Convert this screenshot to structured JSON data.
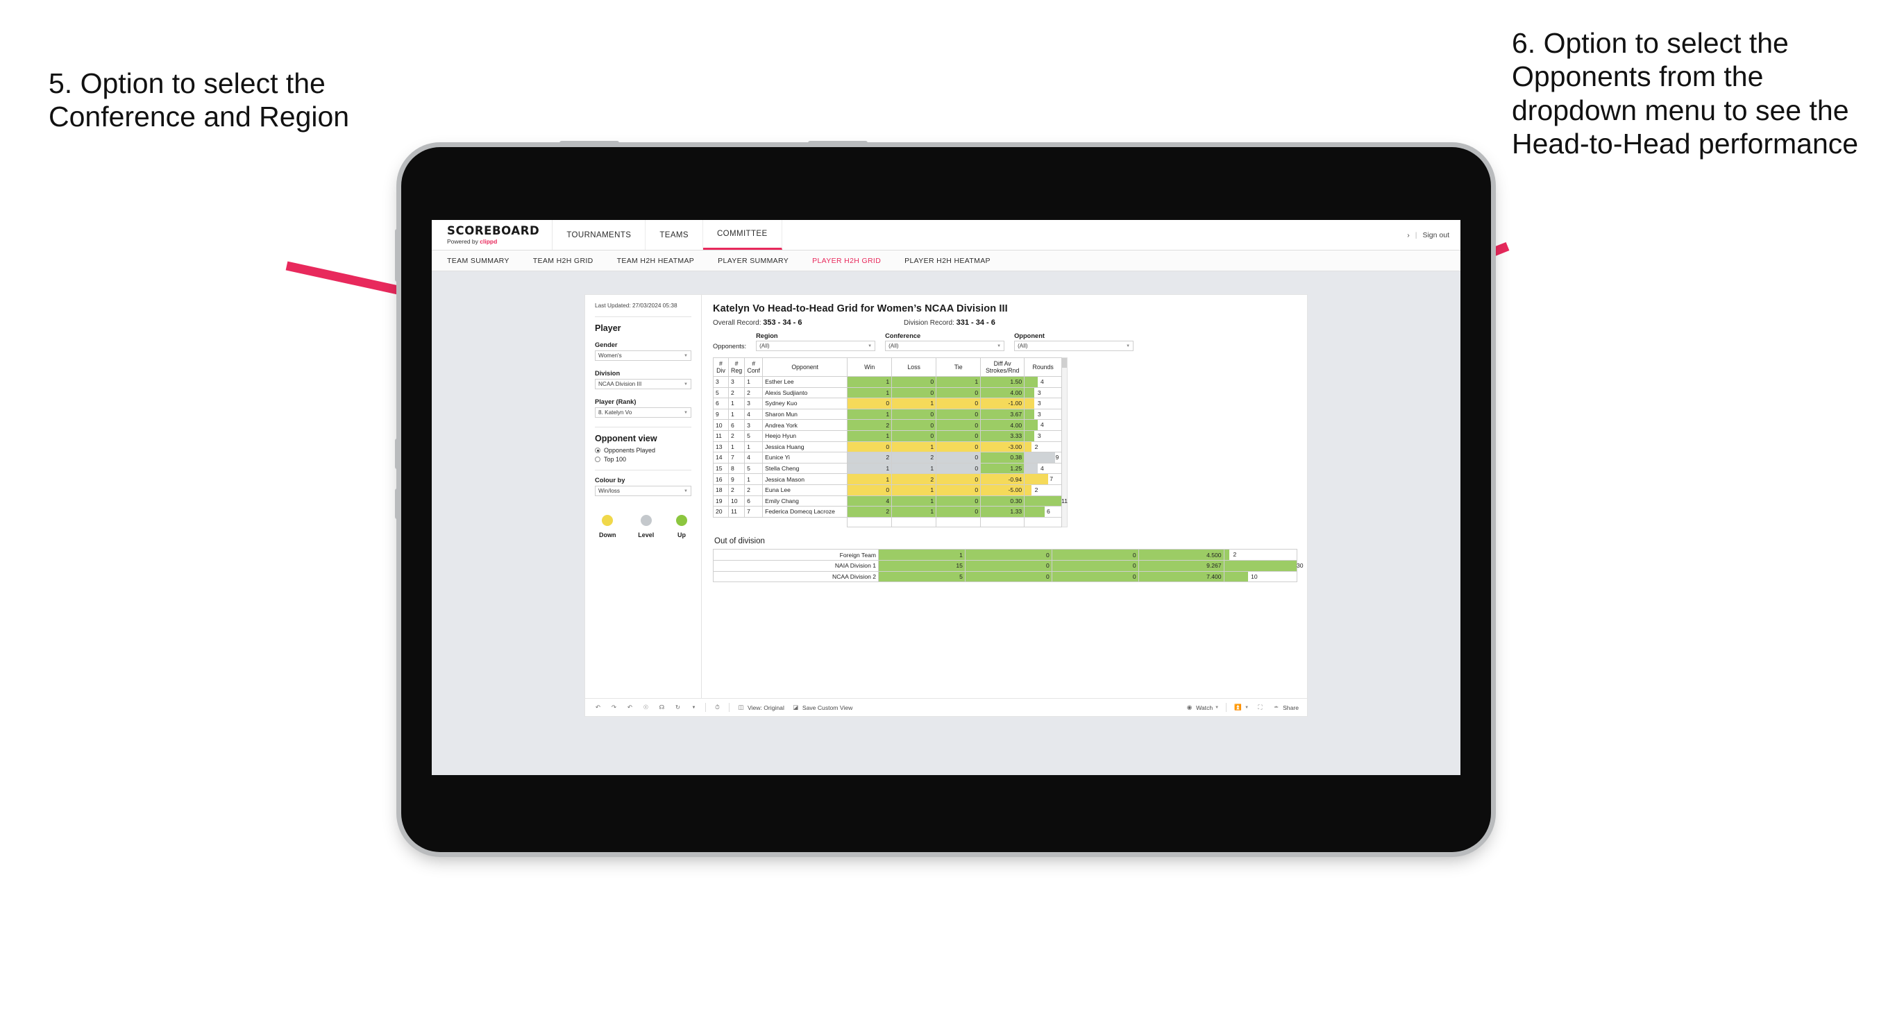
{
  "annotations": {
    "left": "5. Option to select the Conference and Region",
    "right": "6. Option to select the Opponents from the dropdown menu to see the Head-to-Head performance",
    "arrow_color": "#E8295C"
  },
  "app": {
    "brand": {
      "name": "SCOREBOARD",
      "powered_prefix": "Powered by ",
      "powered_brand": "clippd"
    },
    "topnav": [
      {
        "label": "TOURNAMENTS",
        "active": false
      },
      {
        "label": "TEAMS",
        "active": false
      },
      {
        "label": "COMMITTEE",
        "active": true
      }
    ],
    "topbar_right": {
      "chevron": "›",
      "separator": "|",
      "sign_out": "Sign out"
    },
    "subnav": [
      {
        "label": "TEAM SUMMARY",
        "active": false
      },
      {
        "label": "TEAM H2H GRID",
        "active": false
      },
      {
        "label": "TEAM H2H HEATMAP",
        "active": false
      },
      {
        "label": "PLAYER SUMMARY",
        "active": false
      },
      {
        "label": "PLAYER H2H GRID",
        "active": true
      },
      {
        "label": "PLAYER H2H HEATMAP",
        "active": false
      }
    ]
  },
  "sidebar": {
    "last_updated": "Last Updated: 27/03/2024 05:38",
    "player_heading": "Player",
    "fields": [
      {
        "label": "Gender",
        "value": "Women's"
      },
      {
        "label": "Division",
        "value": "NCAA Division III"
      },
      {
        "label": "Player (Rank)",
        "value": "8. Katelyn Vo"
      }
    ],
    "opponent_view": {
      "heading": "Opponent view",
      "options": [
        {
          "label": "Opponents Played",
          "selected": true
        },
        {
          "label": "Top 100",
          "selected": false
        }
      ]
    },
    "colour_by": {
      "label": "Colour by",
      "value": "Win/loss"
    },
    "legend": [
      {
        "label": "Down",
        "color": "#F0D84A"
      },
      {
        "label": "Level",
        "color": "#C4C8CC"
      },
      {
        "label": "Up",
        "color": "#8CC63F"
      }
    ]
  },
  "viz": {
    "title": "Katelyn Vo Head-to-Head Grid for Women’s NCAA Division III",
    "overall_record_label": "Overall Record:",
    "overall_record_value": "353 - 34 - 6",
    "division_record_label": "Division Record:",
    "division_record_value": "331 - 34 - 6",
    "opponents_label": "Opponents:",
    "filters": [
      {
        "label": "Region",
        "value": "(All)"
      },
      {
        "label": "Conference",
        "value": "(All)"
      },
      {
        "label": "Opponent",
        "value": "(All)"
      }
    ]
  },
  "chart_data": {
    "type": "table",
    "title": "Katelyn Vo Head-to-Head Grid for Women’s NCAA Division III",
    "columns": [
      "# Div",
      "# Reg",
      "# Conf",
      "Opponent",
      "Win",
      "Loss",
      "Tie",
      "Diff Av Strokes/Rnd",
      "Rounds"
    ],
    "headers_two_line": [
      {
        "top": "#",
        "bottom": "Div"
      },
      {
        "top": "#",
        "bottom": "Reg"
      },
      {
        "top": "#",
        "bottom": "Conf"
      },
      {
        "top": "Opponent",
        "bottom": ""
      },
      {
        "top": "Win",
        "bottom": ""
      },
      {
        "top": "Loss",
        "bottom": ""
      },
      {
        "top": "Tie",
        "bottom": ""
      },
      {
        "top": "Diff Av",
        "bottom": "Strokes/Rnd"
      },
      {
        "top": "Rounds",
        "bottom": ""
      }
    ],
    "rounds_max": 11,
    "rows": [
      {
        "div": "3",
        "reg": "3",
        "conf": "1",
        "opponent": "Esther Lee",
        "win": "1",
        "loss": "0",
        "tie": "1",
        "diff": "1.50",
        "rounds": 4,
        "state": "up"
      },
      {
        "div": "5",
        "reg": "2",
        "conf": "2",
        "opponent": "Alexis Sudjianto",
        "win": "1",
        "loss": "0",
        "tie": "0",
        "diff": "4.00",
        "rounds": 3,
        "state": "up"
      },
      {
        "div": "6",
        "reg": "1",
        "conf": "3",
        "opponent": "Sydney Kuo",
        "win": "0",
        "loss": "1",
        "tie": "0",
        "diff": "-1.00",
        "rounds": 3,
        "state": "down"
      },
      {
        "div": "9",
        "reg": "1",
        "conf": "4",
        "opponent": "Sharon Mun",
        "win": "1",
        "loss": "0",
        "tie": "0",
        "diff": "3.67",
        "rounds": 3,
        "state": "up"
      },
      {
        "div": "10",
        "reg": "6",
        "conf": "3",
        "opponent": "Andrea York",
        "win": "2",
        "loss": "0",
        "tie": "0",
        "diff": "4.00",
        "rounds": 4,
        "state": "up"
      },
      {
        "div": "11",
        "reg": "2",
        "conf": "5",
        "opponent": "Heejo Hyun",
        "win": "1",
        "loss": "0",
        "tie": "0",
        "diff": "3.33",
        "rounds": 3,
        "state": "up"
      },
      {
        "div": "13",
        "reg": "1",
        "conf": "1",
        "opponent": "Jessica Huang",
        "win": "0",
        "loss": "1",
        "tie": "0",
        "diff": "-3.00",
        "rounds": 2,
        "state": "down"
      },
      {
        "div": "14",
        "reg": "7",
        "conf": "4",
        "opponent": "Eunice Yi",
        "win": "2",
        "loss": "2",
        "tie": "0",
        "diff": "0.38",
        "rounds": 9,
        "state": "level",
        "diff_state": "up"
      },
      {
        "div": "15",
        "reg": "8",
        "conf": "5",
        "opponent": "Stella Cheng",
        "win": "1",
        "loss": "1",
        "tie": "0",
        "diff": "1.25",
        "rounds": 4,
        "state": "level",
        "diff_state": "up"
      },
      {
        "div": "16",
        "reg": "9",
        "conf": "1",
        "opponent": "Jessica Mason",
        "win": "1",
        "loss": "2",
        "tie": "0",
        "diff": "-0.94",
        "rounds": 7,
        "state": "down"
      },
      {
        "div": "18",
        "reg": "2",
        "conf": "2",
        "opponent": "Euna Lee",
        "win": "0",
        "loss": "1",
        "tie": "0",
        "diff": "-5.00",
        "rounds": 2,
        "state": "down"
      },
      {
        "div": "19",
        "reg": "10",
        "conf": "6",
        "opponent": "Emily Chang",
        "win": "4",
        "loss": "1",
        "tie": "0",
        "diff": "0.30",
        "rounds": 11,
        "state": "up"
      },
      {
        "div": "20",
        "reg": "11",
        "conf": "7",
        "opponent": "Federica Domecq Lacroze",
        "win": "2",
        "loss": "1",
        "tie": "0",
        "diff": "1.33",
        "rounds": 6,
        "state": "up"
      }
    ],
    "out_of_division": {
      "title": "Out of division",
      "rounds_max": 30,
      "rows": [
        {
          "name": "Foreign Team",
          "win": "1",
          "loss": "0",
          "tie": "0",
          "diff": "4.500",
          "rounds": 2,
          "state": "up"
        },
        {
          "name": "NAIA Division 1",
          "win": "15",
          "loss": "0",
          "tie": "0",
          "diff": "9.267",
          "rounds": 30,
          "state": "up"
        },
        {
          "name": "NCAA Division 2",
          "win": "5",
          "loss": "0",
          "tie": "0",
          "diff": "7.400",
          "rounds": 10,
          "state": "up"
        }
      ]
    }
  },
  "toolbar": {
    "icons": [
      "undo-icon",
      "redo-icon",
      "revert-icon",
      "refresh-icon",
      "pause-icon",
      "reset-icon",
      "chevron-down-icon",
      "clock-icon"
    ],
    "view_label": "View: Original",
    "save_label": "Save Custom View",
    "watch_label": "Watch",
    "share_label": "Share"
  }
}
